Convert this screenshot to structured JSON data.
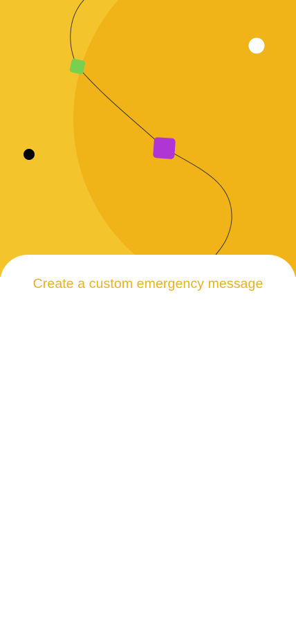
{
  "onboarding": {
    "title": "Create a custom emergency message"
  },
  "illustration": {
    "icons": [
      "green-square-icon",
      "purple-square-icon",
      "white-dot-icon",
      "black-dot-icon"
    ]
  },
  "colors": {
    "background_yellow": "#F3C42B",
    "blob_amber": "#F0B318",
    "sheet_white": "#FFFFFF",
    "title_amber": "#E9B124",
    "curve_line": "#2B2B2B",
    "green_square": "#78D050",
    "purple_square": "#B035D5",
    "white_dot": "#FFFFFF",
    "black_dot": "#000000"
  }
}
